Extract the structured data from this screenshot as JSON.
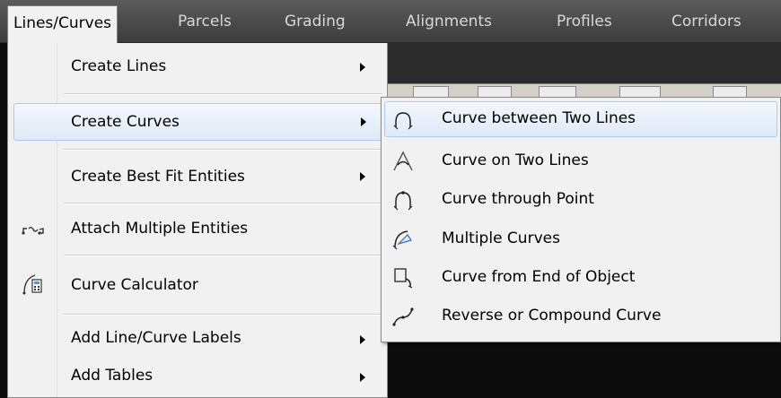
{
  "menubar": {
    "items": [
      {
        "label": "Lines/Curves",
        "active": true
      },
      {
        "label": "Parcels"
      },
      {
        "label": "Grading"
      },
      {
        "label": "Alignments"
      },
      {
        "label": "Profiles"
      },
      {
        "label": "Corridors"
      }
    ]
  },
  "primary_menu": {
    "items": [
      {
        "label": "Create Lines",
        "submenu": true
      },
      {
        "label": "Create Curves",
        "submenu": true,
        "highlighted": true
      },
      {
        "label": "Create Best Fit Entities",
        "submenu": true
      },
      {
        "label": "Attach Multiple Entities",
        "icon": "attach-entities-icon"
      },
      {
        "label": "Curve Calculator",
        "icon": "curve-calculator-icon"
      },
      {
        "label": "Add Line/Curve Labels",
        "submenu": true
      },
      {
        "label": "Add Tables",
        "submenu": true
      }
    ]
  },
  "submenu": {
    "items": [
      {
        "label": "Curve between Two Lines",
        "icon": "curve-between-lines-icon",
        "highlighted": true
      },
      {
        "label": "Curve on Two Lines",
        "icon": "curve-on-lines-icon"
      },
      {
        "label": "Curve through Point",
        "icon": "curve-through-point-icon"
      },
      {
        "label": "Multiple Curves",
        "icon": "multiple-curves-icon"
      },
      {
        "label": "Curve from End of Object",
        "icon": "curve-from-end-icon"
      },
      {
        "label": "Reverse or Compound Curve",
        "icon": "reverse-compound-curve-icon"
      }
    ]
  },
  "colors": {
    "menubar_bg": "#4a4a4a",
    "menu_bg": "#f1f1f1",
    "highlight_border": "#aecaf0",
    "app_bg": "#0b0b0b"
  }
}
